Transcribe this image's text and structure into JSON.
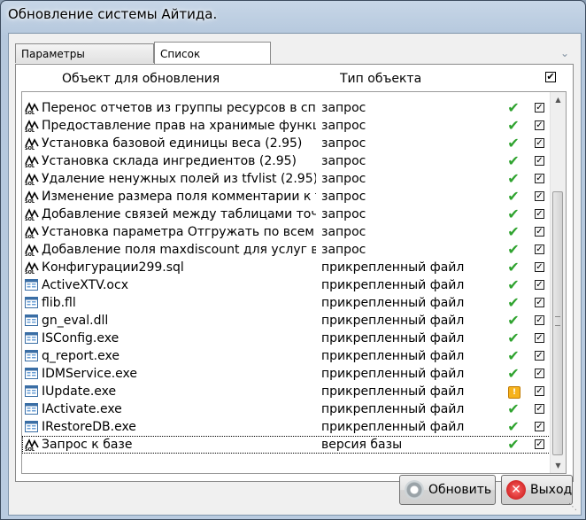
{
  "window": {
    "title": "Обновление системы Айтида."
  },
  "tabs": [
    {
      "label": "Параметры обновления"
    },
    {
      "label": "Список обновления"
    }
  ],
  "columns": {
    "object": "Объект для обновления",
    "type": "Тип объекта"
  },
  "header_checkbox": "✔",
  "rows": [
    {
      "icon": "sql-icon",
      "name": "Перенос отчетов из группы ресурсов в спис",
      "type": "запрос",
      "status": "ok",
      "checked": true
    },
    {
      "icon": "sql-icon",
      "name": "Предоставление прав на хранимые функци",
      "type": "запрос",
      "status": "ok",
      "checked": true
    },
    {
      "icon": "sql-icon",
      "name": "Установка базовой единицы веса (2.95)",
      "type": "запрос",
      "status": "ok",
      "checked": true
    },
    {
      "icon": "sql-icon",
      "name": "Установка склада ингредиентов (2.95)",
      "type": "запрос",
      "status": "ok",
      "checked": true
    },
    {
      "icon": "sql-icon",
      "name": "Удаление ненужных полей из tfvlist (2.95)",
      "type": "запрос",
      "status": "ok",
      "checked": true
    },
    {
      "icon": "sql-icon",
      "name": "Изменение размера поля комментарии к то",
      "type": "запрос",
      "status": "ok",
      "checked": true
    },
    {
      "icon": "sql-icon",
      "name": "Добавление связей между таблицами точки",
      "type": "запрос",
      "status": "ok",
      "checked": true
    },
    {
      "icon": "sql-icon",
      "name": "Установка параметра Отгружать по всем уч",
      "type": "запрос",
      "status": "ok",
      "checked": true
    },
    {
      "icon": "sql-icon",
      "name": "Добавление поля maxdiscount для услуг в tfv",
      "type": "запрос",
      "status": "ok",
      "checked": true
    },
    {
      "icon": "sql-icon",
      "name": "Конфигурации299.sql",
      "type": "прикрепленный файл",
      "status": "ok",
      "checked": true
    },
    {
      "icon": "file-icon",
      "name": "ActiveXTV.ocx",
      "type": "прикрепленный файл",
      "status": "ok",
      "checked": true
    },
    {
      "icon": "file-icon",
      "name": "flib.fll",
      "type": "прикрепленный файл",
      "status": "ok",
      "checked": true
    },
    {
      "icon": "file-icon",
      "name": "gn_eval.dll",
      "type": "прикрепленный файл",
      "status": "ok",
      "checked": true
    },
    {
      "icon": "file-icon",
      "name": "ISConfig.exe",
      "type": "прикрепленный файл",
      "status": "ok",
      "checked": true
    },
    {
      "icon": "file-icon",
      "name": "q_report.exe",
      "type": "прикрепленный файл",
      "status": "ok",
      "checked": true
    },
    {
      "icon": "file-icon",
      "name": "IDMService.exe",
      "type": "прикрепленный файл",
      "status": "ok",
      "checked": true
    },
    {
      "icon": "file-icon",
      "name": "IUpdate.exe",
      "type": "прикрепленный файл",
      "status": "warning",
      "checked": true
    },
    {
      "icon": "file-icon",
      "name": "IActivate.exe",
      "type": "прикрепленный файл",
      "status": "ok",
      "checked": true
    },
    {
      "icon": "file-icon",
      "name": "IRestoreDB.exe",
      "type": "прикрепленный файл",
      "status": "ok",
      "checked": true
    },
    {
      "icon": "sql-icon",
      "name": "Запрос к базе",
      "type": "версия базы",
      "status": "ok",
      "checked": true
    }
  ],
  "buttons": {
    "update": "Обновить",
    "exit": "Выход"
  },
  "colors": {
    "ok": "#2fa32f",
    "warning": "#f6b21b"
  }
}
